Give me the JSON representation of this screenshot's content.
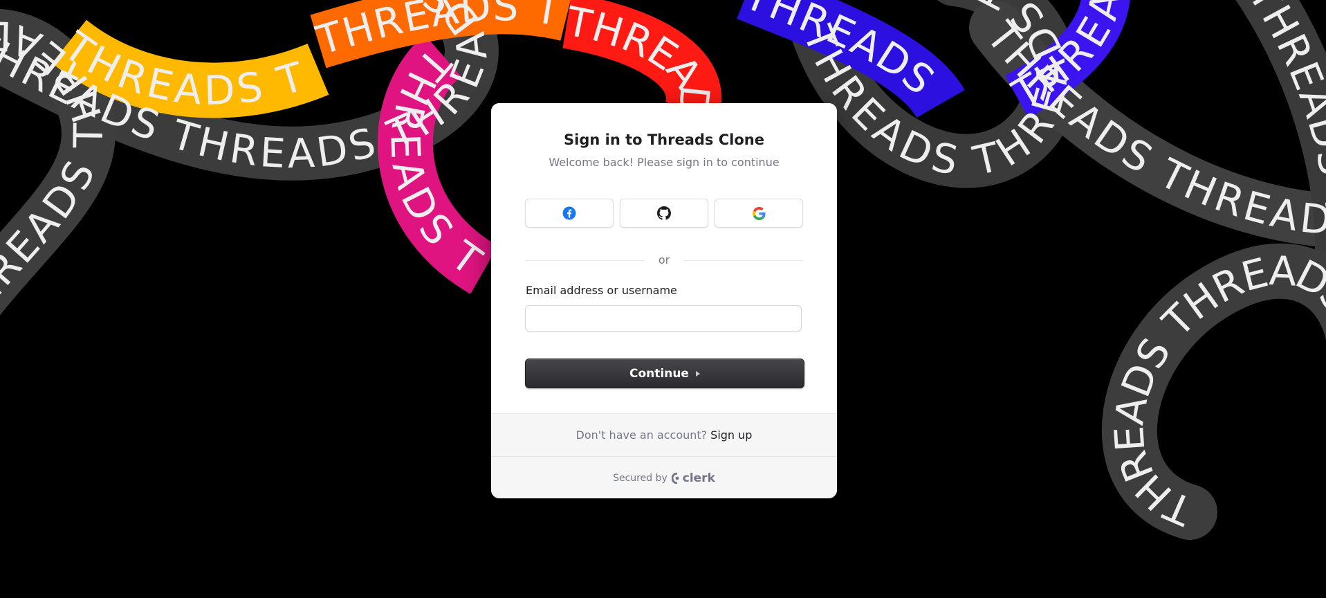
{
  "background": {
    "ribbon_text": "THREADS THREADS THREADS THREADS THREADS",
    "colors": {
      "gray": "#5a5a5a",
      "yellow": "#ffbc00",
      "orange": "#ff6a00",
      "red": "#ff1a14",
      "magenta": "#e01480",
      "blue": "#2b10e0",
      "text": "#efefef"
    }
  },
  "card": {
    "title": "Sign in to Threads Clone",
    "subtitle": "Welcome back! Please sign in to continue",
    "social": [
      {
        "provider": "facebook",
        "icon": "facebook-icon"
      },
      {
        "provider": "github",
        "icon": "github-icon"
      },
      {
        "provider": "google",
        "icon": "google-icon"
      }
    ],
    "divider_text": "or",
    "email_label": "Email address or username",
    "email_value": "",
    "email_placeholder": "",
    "continue_label": "Continue"
  },
  "footer": {
    "signup_prompt": "Don't have an account?",
    "signup_link": "Sign up",
    "secured_by": "Secured by",
    "brand": "clerk"
  }
}
